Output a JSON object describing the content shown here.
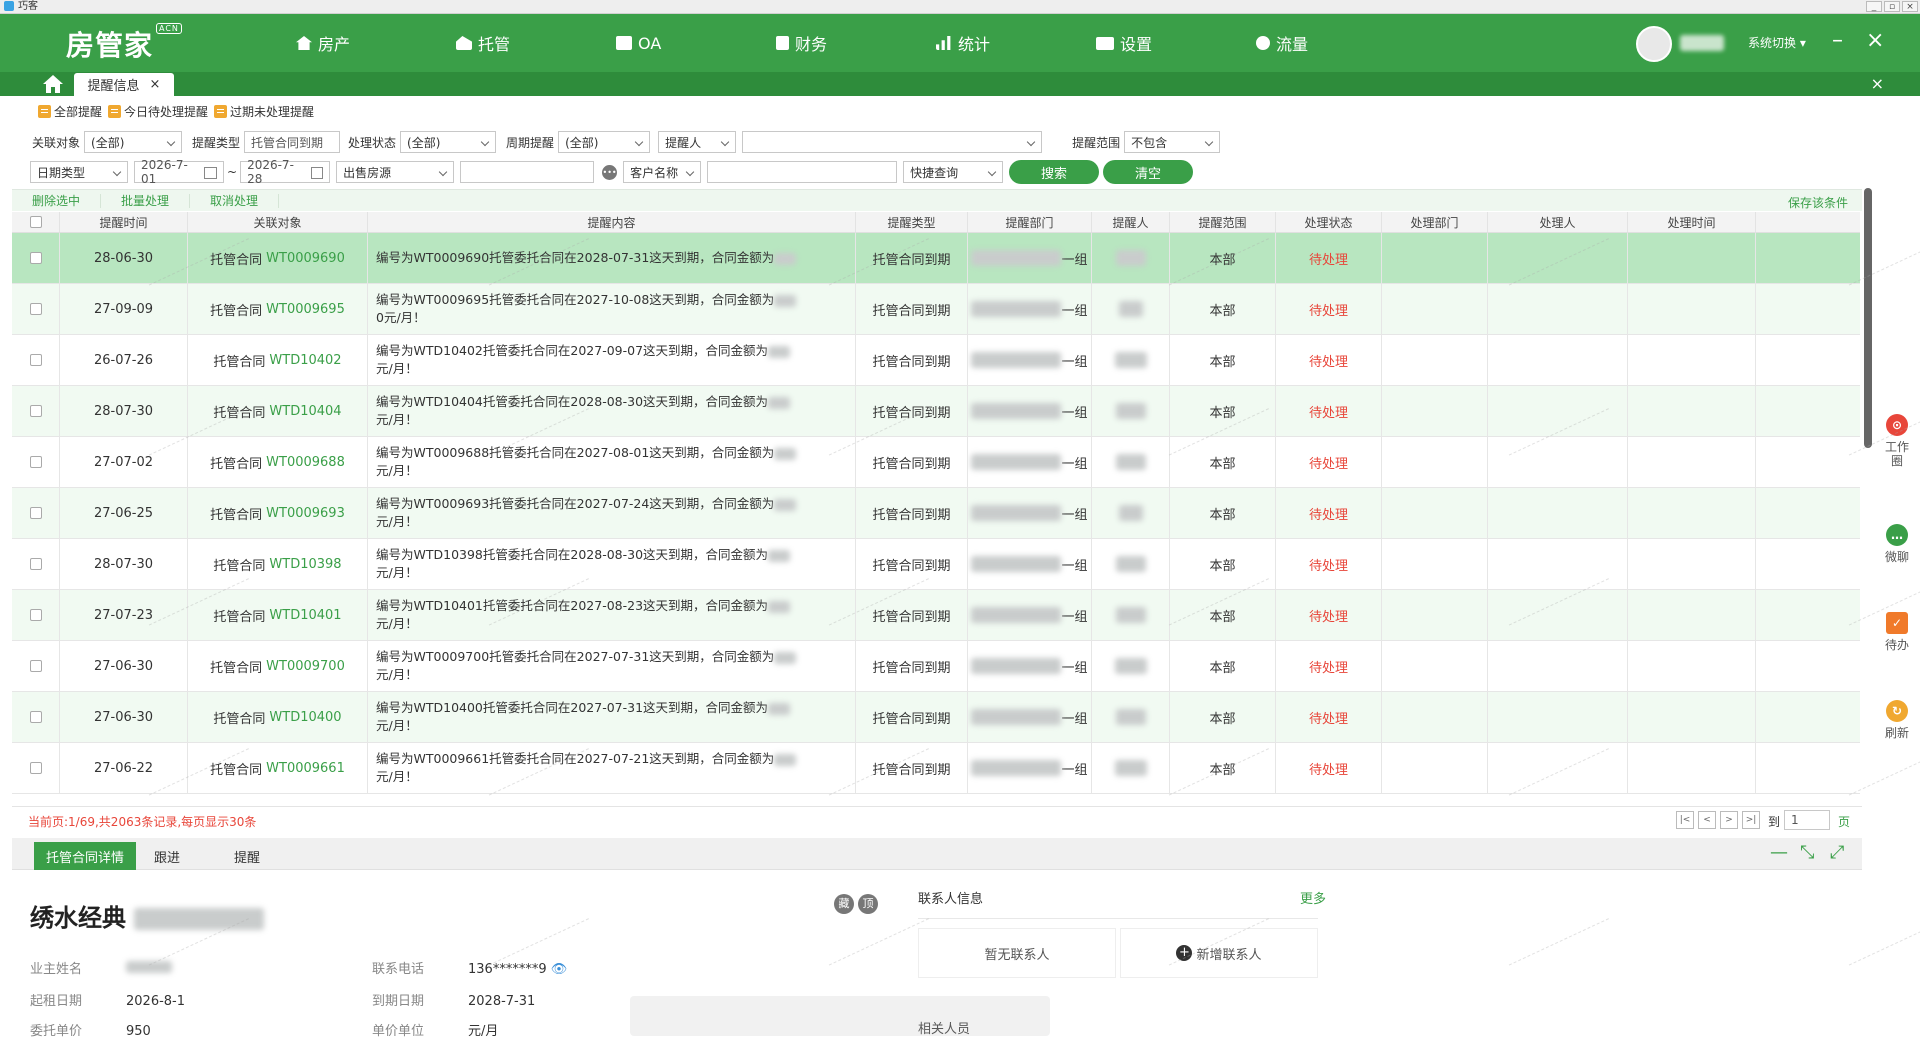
{
  "window": {
    "title": "巧客"
  },
  "topnav": {
    "logo": "房管家",
    "logo_badge": "ACN",
    "items": [
      {
        "label": "房产",
        "icon": "house-icon"
      },
      {
        "label": "托管",
        "icon": "home-hand-icon"
      },
      {
        "label": "OA",
        "icon": "briefcase-icon"
      },
      {
        "label": "财务",
        "icon": "wallet-icon"
      },
      {
        "label": "统计",
        "icon": "chart-icon"
      },
      {
        "label": "设置",
        "icon": "monitor-icon"
      },
      {
        "label": "流量",
        "icon": "traffic-icon"
      }
    ],
    "system_switch": "系统切换"
  },
  "tabs": {
    "active": "提醒信息"
  },
  "reminder_filters": [
    "全部提醒",
    "今日待处理提醒",
    "过期未处理提醒"
  ],
  "filters": {
    "related_object_label": "关联对象",
    "related_object_value": "(全部)",
    "reminder_type_label": "提醒类型",
    "reminder_type_value": "托管合同到期",
    "status_label": "处理状态",
    "status_value": "(全部)",
    "periodic_label": "周期提醒",
    "periodic_value": "(全部)",
    "reminder_person_value": "提醒人",
    "scope_label": "提醒范围",
    "scope_value": "不包含",
    "date_type_value": "日期类型",
    "date_from": "2026-7-01",
    "date_sep": "~",
    "date_to": "2026-7-28",
    "property_source_value": "出售房源",
    "customer_name_value": "客户名称",
    "quick_query_value": "快捷查询",
    "search_label": "搜索",
    "clear_label": "清空"
  },
  "toolbar": {
    "delete": "删除选中",
    "batch": "批量处理",
    "cancel": "取消处理",
    "save_conditions": "保存该条件"
  },
  "table": {
    "headers": [
      "提醒时间",
      "关联对象",
      "提醒内容",
      "提醒类型",
      "提醒部门",
      "提醒人",
      "提醒范围",
      "处理状态",
      "处理部门",
      "处理人",
      "处理时间"
    ],
    "rows": [
      {
        "time": "28-06-30",
        "obj_type": "托管合同",
        "obj_id": "WT0009690",
        "content": "编号为WT0009690托管委托合同在2028-07-31这天到期，合同金额为",
        "type": "托管合同到期",
        "dept_suffix": "一组",
        "scope": "本部",
        "status": "待处理"
      },
      {
        "time": "27-09-09",
        "obj_type": "托管合同",
        "obj_id": "WT0009695",
        "content": "编号为WT0009695托管委托合同在2027-10-08这天到期，合同金额为",
        "content_tail": "0元/月！",
        "type": "托管合同到期",
        "dept_suffix": "一组",
        "scope": "本部",
        "status": "待处理"
      },
      {
        "time": "26-07-26",
        "obj_type": "托管合同",
        "obj_id": "WTD10402",
        "content": "编号为WTD10402托管委托合同在2027-09-07这天到期，合同金额为",
        "content_tail": "元/月！",
        "type": "托管合同到期",
        "dept_suffix": "一组",
        "scope": "本部",
        "status": "待处理"
      },
      {
        "time": "28-07-30",
        "obj_type": "托管合同",
        "obj_id": "WTD10404",
        "content": "编号为WTD10404托管委托合同在2028-08-30这天到期，合同金额为",
        "content_tail": "元/月！",
        "type": "托管合同到期",
        "dept_suffix": "一组",
        "scope": "本部",
        "status": "待处理"
      },
      {
        "time": "27-07-02",
        "obj_type": "托管合同",
        "obj_id": "WT0009688",
        "content": "编号为WT0009688托管委托合同在2027-08-01这天到期，合同金额为",
        "content_tail": "元/月！",
        "type": "托管合同到期",
        "dept_suffix": "一组",
        "scope": "本部",
        "status": "待处理"
      },
      {
        "time": "27-06-25",
        "obj_type": "托管合同",
        "obj_id": "WT0009693",
        "content": "编号为WT0009693托管委托合同在2027-07-24这天到期，合同金额为",
        "content_tail": "元/月！",
        "type": "托管合同到期",
        "dept_suffix": "一组",
        "scope": "本部",
        "status": "待处理"
      },
      {
        "time": "28-07-30",
        "obj_type": "托管合同",
        "obj_id": "WTD10398",
        "content": "编号为WTD10398托管委托合同在2028-08-30这天到期，合同金额为",
        "content_tail": "元/月！",
        "type": "托管合同到期",
        "dept_suffix": "一组",
        "scope": "本部",
        "status": "待处理"
      },
      {
        "time": "27-07-23",
        "obj_type": "托管合同",
        "obj_id": "WTD10401",
        "content": "编号为WTD10401托管委托合同在2027-08-23这天到期，合同金额为",
        "content_tail": "元/月！",
        "type": "托管合同到期",
        "dept_suffix": "一组",
        "scope": "本部",
        "status": "待处理"
      },
      {
        "time": "27-06-30",
        "obj_type": "托管合同",
        "obj_id": "WT0009700",
        "content": "编号为WT0009700托管委托合同在2027-07-31这天到期，合同金额为",
        "content_tail": "元/月！",
        "type": "托管合同到期",
        "dept_suffix": "一组",
        "scope": "本部",
        "status": "待处理"
      },
      {
        "time": "27-06-30",
        "obj_type": "托管合同",
        "obj_id": "WTD10400",
        "content": "编号为WTD10400托管委托合同在2027-07-31这天到期，合同金额为",
        "content_tail": "元/月！",
        "type": "托管合同到期",
        "dept_suffix": "一组",
        "scope": "本部",
        "status": "待处理"
      },
      {
        "time": "27-06-22",
        "obj_type": "托管合同",
        "obj_id": "WT0009661",
        "content": "编号为WT0009661托管委托合同在2027-07-21这天到期，合同金额为",
        "content_tail": "元/月！",
        "type": "托管合同到期",
        "dept_suffix": "一组",
        "scope": "本部",
        "status": "待处理"
      }
    ]
  },
  "pager": {
    "info": "当前页:1/69,共2063条记录,每页显示30条",
    "to_label": "到",
    "page_value": "1",
    "page_unit": "页"
  },
  "detail_tabs": [
    "托管合同详情",
    "跟进",
    "提醒"
  ],
  "detail": {
    "title": "绣水经典",
    "badges": [
      "藏",
      "顶"
    ],
    "owner_label": "业主姓名",
    "phone_label": "联系电话",
    "phone_value": "136*******9",
    "start_label": "起租日期",
    "start_value": "2026-8-1",
    "end_label": "到期日期",
    "end_value": "2028-7-31",
    "unit_price_label": "委托单价",
    "unit_price_value": "950",
    "price_unit_label": "单价单位",
    "price_unit_value": "元/月",
    "contact_info": "联系人信息",
    "more": "更多",
    "no_contact": "暂无联系人",
    "add_contact": "新增联系人",
    "related_staff": "相关人员"
  },
  "right_panel": [
    {
      "label": "工作圈",
      "color": "#e8463a"
    },
    {
      "label": "微聊",
      "color": "#3a9f48"
    },
    {
      "label": "待办",
      "color": "#f07a2a"
    },
    {
      "label": "刷新",
      "color": "#f0a830"
    }
  ]
}
